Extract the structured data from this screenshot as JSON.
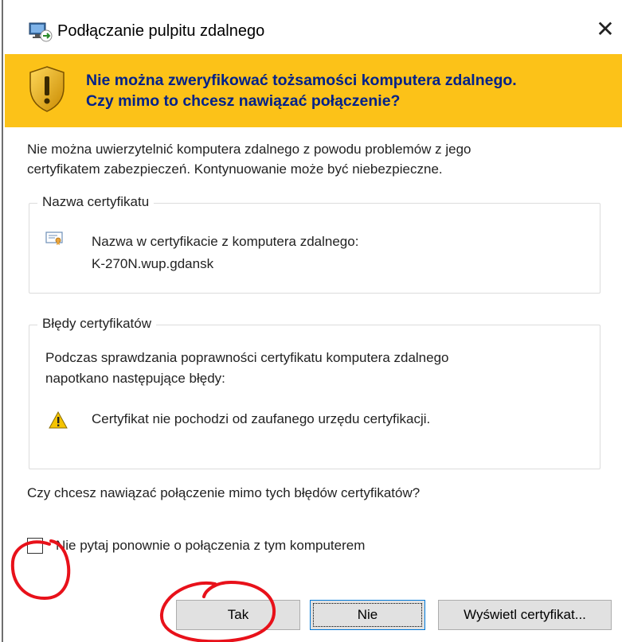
{
  "window": {
    "title": "Podłączanie pulpitu zdalnego",
    "close_glyph": "✕"
  },
  "banner": {
    "line1": "Nie można zweryfikować tożsamości komputera zdalnego.",
    "line2": "Czy mimo to chcesz nawiązać połączenie?",
    "background": "#fcc218",
    "text_color": "#00218a"
  },
  "intro": {
    "line1": "Nie można uwierzytelnić komputera zdalnego z powodu problemów z jego",
    "line2": "certyfikatem zabezpieczeń. Kontynuowanie może być niebezpieczne."
  },
  "cert_name_group": {
    "legend": "Nazwa certyfikatu",
    "label": "Nazwa w certyfikacie z komputera zdalnego:",
    "value": "K-270N.wup.gdansk",
    "icon": "certificate-icon"
  },
  "cert_errors_group": {
    "legend": "Błędy certyfikatów",
    "line1": "Podczas sprawdzania poprawności certyfikatu komputera zdalnego",
    "line2": "napotkano następujące błędy:",
    "error": "Certyfikat nie pochodzi od zaufanego urzędu certyfikacji.",
    "icon": "warning-icon"
  },
  "question": "Czy chcesz nawiązać połączenie mimo tych błędów certyfikatów?",
  "dont_ask_checkbox": {
    "label": "Nie pytaj ponownie o połączenia z tym komputerem",
    "checked": false
  },
  "buttons": {
    "yes": "Tak",
    "no": "Nie",
    "view_cert": "Wyświetl certyfikat..."
  },
  "annotation_color": "#e8111a"
}
